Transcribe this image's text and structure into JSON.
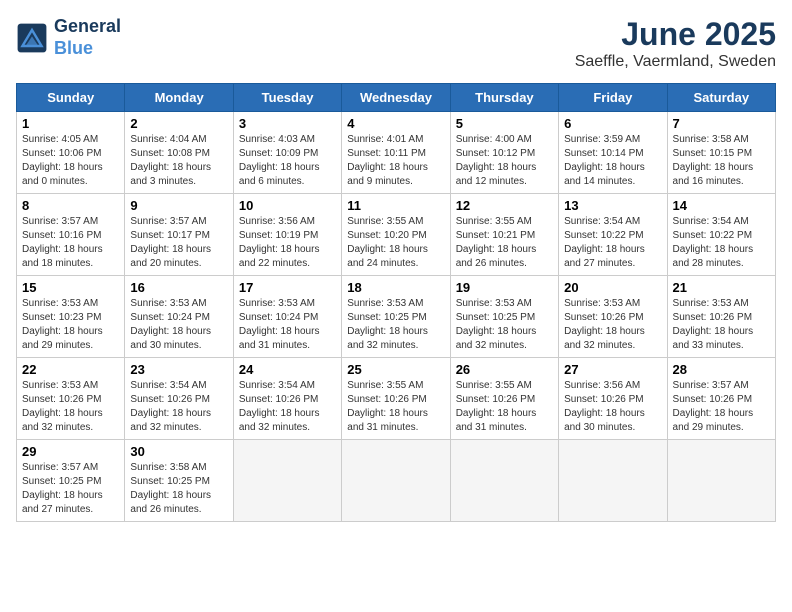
{
  "header": {
    "logo_line1": "General",
    "logo_line2": "Blue",
    "month": "June 2025",
    "location": "Saeffle, Vaermland, Sweden"
  },
  "weekdays": [
    "Sunday",
    "Monday",
    "Tuesday",
    "Wednesday",
    "Thursday",
    "Friday",
    "Saturday"
  ],
  "weeks": [
    [
      {
        "day": "1",
        "sunrise": "4:05 AM",
        "sunset": "10:06 PM",
        "daylight": "18 hours and 0 minutes."
      },
      {
        "day": "2",
        "sunrise": "4:04 AM",
        "sunset": "10:08 PM",
        "daylight": "18 hours and 3 minutes."
      },
      {
        "day": "3",
        "sunrise": "4:03 AM",
        "sunset": "10:09 PM",
        "daylight": "18 hours and 6 minutes."
      },
      {
        "day": "4",
        "sunrise": "4:01 AM",
        "sunset": "10:11 PM",
        "daylight": "18 hours and 9 minutes."
      },
      {
        "day": "5",
        "sunrise": "4:00 AM",
        "sunset": "10:12 PM",
        "daylight": "18 hours and 12 minutes."
      },
      {
        "day": "6",
        "sunrise": "3:59 AM",
        "sunset": "10:14 PM",
        "daylight": "18 hours and 14 minutes."
      },
      {
        "day": "7",
        "sunrise": "3:58 AM",
        "sunset": "10:15 PM",
        "daylight": "18 hours and 16 minutes."
      }
    ],
    [
      {
        "day": "8",
        "sunrise": "3:57 AM",
        "sunset": "10:16 PM",
        "daylight": "18 hours and 18 minutes."
      },
      {
        "day": "9",
        "sunrise": "3:57 AM",
        "sunset": "10:17 PM",
        "daylight": "18 hours and 20 minutes."
      },
      {
        "day": "10",
        "sunrise": "3:56 AM",
        "sunset": "10:19 PM",
        "daylight": "18 hours and 22 minutes."
      },
      {
        "day": "11",
        "sunrise": "3:55 AM",
        "sunset": "10:20 PM",
        "daylight": "18 hours and 24 minutes."
      },
      {
        "day": "12",
        "sunrise": "3:55 AM",
        "sunset": "10:21 PM",
        "daylight": "18 hours and 26 minutes."
      },
      {
        "day": "13",
        "sunrise": "3:54 AM",
        "sunset": "10:22 PM",
        "daylight": "18 hours and 27 minutes."
      },
      {
        "day": "14",
        "sunrise": "3:54 AM",
        "sunset": "10:22 PM",
        "daylight": "18 hours and 28 minutes."
      }
    ],
    [
      {
        "day": "15",
        "sunrise": "3:53 AM",
        "sunset": "10:23 PM",
        "daylight": "18 hours and 29 minutes."
      },
      {
        "day": "16",
        "sunrise": "3:53 AM",
        "sunset": "10:24 PM",
        "daylight": "18 hours and 30 minutes."
      },
      {
        "day": "17",
        "sunrise": "3:53 AM",
        "sunset": "10:24 PM",
        "daylight": "18 hours and 31 minutes."
      },
      {
        "day": "18",
        "sunrise": "3:53 AM",
        "sunset": "10:25 PM",
        "daylight": "18 hours and 32 minutes."
      },
      {
        "day": "19",
        "sunrise": "3:53 AM",
        "sunset": "10:25 PM",
        "daylight": "18 hours and 32 minutes."
      },
      {
        "day": "20",
        "sunrise": "3:53 AM",
        "sunset": "10:26 PM",
        "daylight": "18 hours and 32 minutes."
      },
      {
        "day": "21",
        "sunrise": "3:53 AM",
        "sunset": "10:26 PM",
        "daylight": "18 hours and 33 minutes."
      }
    ],
    [
      {
        "day": "22",
        "sunrise": "3:53 AM",
        "sunset": "10:26 PM",
        "daylight": "18 hours and 32 minutes."
      },
      {
        "day": "23",
        "sunrise": "3:54 AM",
        "sunset": "10:26 PM",
        "daylight": "18 hours and 32 minutes."
      },
      {
        "day": "24",
        "sunrise": "3:54 AM",
        "sunset": "10:26 PM",
        "daylight": "18 hours and 32 minutes."
      },
      {
        "day": "25",
        "sunrise": "3:55 AM",
        "sunset": "10:26 PM",
        "daylight": "18 hours and 31 minutes."
      },
      {
        "day": "26",
        "sunrise": "3:55 AM",
        "sunset": "10:26 PM",
        "daylight": "18 hours and 31 minutes."
      },
      {
        "day": "27",
        "sunrise": "3:56 AM",
        "sunset": "10:26 PM",
        "daylight": "18 hours and 30 minutes."
      },
      {
        "day": "28",
        "sunrise": "3:57 AM",
        "sunset": "10:26 PM",
        "daylight": "18 hours and 29 minutes."
      }
    ],
    [
      {
        "day": "29",
        "sunrise": "3:57 AM",
        "sunset": "10:25 PM",
        "daylight": "18 hours and 27 minutes."
      },
      {
        "day": "30",
        "sunrise": "3:58 AM",
        "sunset": "10:25 PM",
        "daylight": "18 hours and 26 minutes."
      },
      null,
      null,
      null,
      null,
      null
    ]
  ]
}
